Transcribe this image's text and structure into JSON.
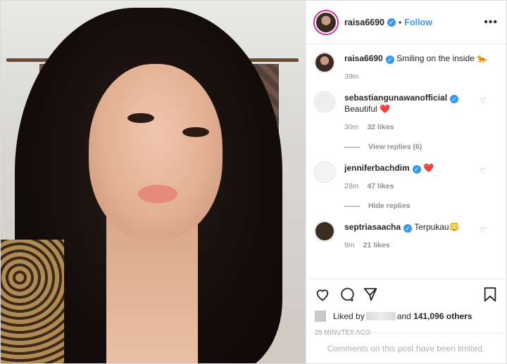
{
  "post": {
    "author": "raisa6690",
    "follow_label": "Follow",
    "caption": "Smiling on the inside 🐆",
    "caption_time": "39m"
  },
  "comments": [
    {
      "user": "sebastiangunawanofficial",
      "text": "Beautiful ❤️",
      "time": "30m",
      "likes": "32 likes",
      "replies": "View replies (6)"
    },
    {
      "user": "jenniferbachdim",
      "text": "❤️",
      "time": "28m",
      "likes": "47 likes",
      "replies": "Hide replies"
    },
    {
      "user": "septriasaacha",
      "text": "Terpukau😳",
      "time": "9m",
      "likes": "21 likes"
    }
  ],
  "footer": {
    "liked_prefix": "Liked by",
    "liked_suffix": "and",
    "liked_count": "141,096 others",
    "timestamp": "39 MINUTES AGO",
    "comments_limited": "Comments on this post have been limited."
  },
  "icons": [
    "heart-icon",
    "comment-icon",
    "share-icon",
    "bookmark-icon",
    "more-icon",
    "verified-icon"
  ],
  "colors": {
    "accent": "#3897f0",
    "muted": "#8e8e8e"
  }
}
